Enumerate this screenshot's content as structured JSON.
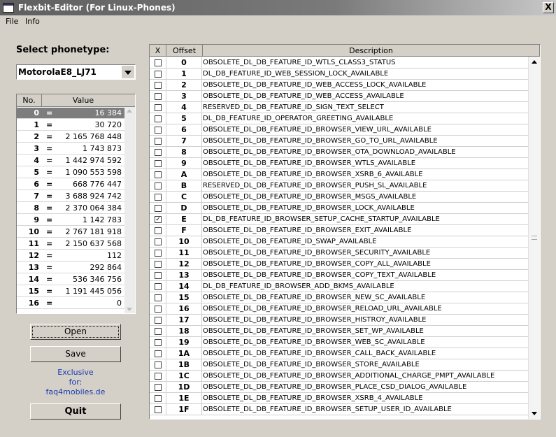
{
  "window": {
    "title": "Flexbit-Editor  (For Linux-Phones)",
    "close_label": "X"
  },
  "menu": [
    {
      "label": "File"
    },
    {
      "label": "Info"
    }
  ],
  "phonetype": {
    "heading": "Select phonetype:",
    "selected": "MotorolaE8_LJ71"
  },
  "value_table": {
    "headers": {
      "no": "No.",
      "value": "Value"
    },
    "selected_index": 0,
    "rows": [
      {
        "no": "0",
        "eq": "=",
        "value": "16 384"
      },
      {
        "no": "1",
        "eq": "=",
        "value": "30 720"
      },
      {
        "no": "2",
        "eq": "=",
        "value": "2 165 768 448"
      },
      {
        "no": "3",
        "eq": "=",
        "value": "1 743 873"
      },
      {
        "no": "4",
        "eq": "=",
        "value": "1 442 974 592"
      },
      {
        "no": "5",
        "eq": "=",
        "value": "1 090 553 598"
      },
      {
        "no": "6",
        "eq": "=",
        "value": "668 776 447"
      },
      {
        "no": "7",
        "eq": "=",
        "value": "3 688 924 742"
      },
      {
        "no": "8",
        "eq": "=",
        "value": "2 370 064 384"
      },
      {
        "no": "9",
        "eq": "=",
        "value": "1 142 783"
      },
      {
        "no": "10",
        "eq": "=",
        "value": "2 767 181 918"
      },
      {
        "no": "11",
        "eq": "=",
        "value": "2 150 637 568"
      },
      {
        "no": "12",
        "eq": "=",
        "value": "112"
      },
      {
        "no": "13",
        "eq": "=",
        "value": "292 864"
      },
      {
        "no": "14",
        "eq": "=",
        "value": "536 346 756"
      },
      {
        "no": "15",
        "eq": "=",
        "value": "1 191 445 056"
      },
      {
        "no": "16",
        "eq": "=",
        "value": "0"
      }
    ]
  },
  "buttons": {
    "open": "Open",
    "save": "Save",
    "quit": "Quit"
  },
  "exclusive": {
    "line1": "Exclusive",
    "line2": "for:",
    "line3": "faq4mobiles.de"
  },
  "feature_table": {
    "headers": {
      "check": "X",
      "offset": "Offset",
      "description": "Description"
    },
    "rows": [
      {
        "checked": false,
        "offset": "0",
        "description": "OBSOLETE_DL_DB_FEATURE_ID_WTLS_CLASS3_STATUS"
      },
      {
        "checked": false,
        "offset": "1",
        "description": "DL_DB_FEATURE_ID_WEB_SESSION_LOCK_AVAILABLE"
      },
      {
        "checked": false,
        "offset": "2",
        "description": "OBSOLETE_DL_DB_FEATURE_ID_WEB_ACCESS_LOCK_AVAILABLE"
      },
      {
        "checked": false,
        "offset": "3",
        "description": "OBSOLETE_DL_DB_FEATURE_ID_WEB_ACCESS_AVAILABLE"
      },
      {
        "checked": false,
        "offset": "4",
        "description": "RESERVED_DL_DB_FEATURE_ID_SIGN_TEXT_SELECT"
      },
      {
        "checked": false,
        "offset": "5",
        "description": "DL_DB_FEATURE_ID_OPERATOR_GREETING_AVAILABLE"
      },
      {
        "checked": false,
        "offset": "6",
        "description": "OBSOLETE_DL_DB_FEATURE_ID_BROWSER_VIEW_URL_AVAILABLE"
      },
      {
        "checked": false,
        "offset": "7",
        "description": "OBSOLETE_DL_DB_FEATURE_ID_BROWSER_GO_TO_URL_AVAILABLE"
      },
      {
        "checked": false,
        "offset": "8",
        "description": "OBSOLETE_DL_DB_FEATURE_ID_BROWSER_OTA_DOWNLOAD_AVAILABLE"
      },
      {
        "checked": false,
        "offset": "9",
        "description": "OBSOLETE_DL_DB_FEATURE_ID_BROWSER_WTLS_AVAILABLE"
      },
      {
        "checked": false,
        "offset": "A",
        "description": "OBSOLETE_DL_DB_FEATURE_ID_BROWSER_XSRB_6_AVAILABLE"
      },
      {
        "checked": false,
        "offset": "B",
        "description": "RESERVED_DL_DB_FEATURE_ID_BROWSER_PUSH_SL_AVAILABLE"
      },
      {
        "checked": false,
        "offset": "C",
        "description": "OBSOLETE_DL_DB_FEATURE_ID_BROWSER_MSGS_AVAILABLE"
      },
      {
        "checked": false,
        "offset": "D",
        "description": "OBSOLETE_DL_DB_FEATURE_ID_BROWSER_LOCK_AVAILABLE"
      },
      {
        "checked": true,
        "offset": "E",
        "description": "DL_DB_FEATURE_ID_BROWSER_SETUP_CACHE_STARTUP_AVAILABLE"
      },
      {
        "checked": false,
        "offset": "F",
        "description": "OBSOLETE_DL_DB_FEATURE_ID_BROWSER_EXIT_AVAILABLE"
      },
      {
        "checked": false,
        "offset": "10",
        "description": "OBSOLETE_DL_DB_FEATURE_ID_SWAP_AVAILABLE"
      },
      {
        "checked": false,
        "offset": "11",
        "description": "OBSOLETE_DL_DB_FEATURE_ID_BROWSER_SECURITY_AVAILABLE"
      },
      {
        "checked": false,
        "offset": "12",
        "description": "OBSOLETE_DL_DB_FEATURE_ID_BROWSER_COPY_ALL_AVAILABLE"
      },
      {
        "checked": false,
        "offset": "13",
        "description": "OBSOLETE_DL_DB_FEATURE_ID_BROWSER_COPY_TEXT_AVAILABLE"
      },
      {
        "checked": false,
        "offset": "14",
        "description": "DL_DB_FEATURE_ID_BROWSER_ADD_BKMS_AVAILABLE"
      },
      {
        "checked": false,
        "offset": "15",
        "description": "OBSOLETE_DL_DB_FEATURE_ID_BROWSER_NEW_SC_AVAILABLE"
      },
      {
        "checked": false,
        "offset": "16",
        "description": "OBSOLETE_DL_DB_FEATURE_ID_BROWSER_RELOAD_URL_AVAILABLE"
      },
      {
        "checked": false,
        "offset": "17",
        "description": "OBSOLETE_DL_DB_FEATURE_ID_BROWSER_HISTROY_AVAILABLE"
      },
      {
        "checked": false,
        "offset": "18",
        "description": "OBSOLETE_DL_DB_FEATURE_ID_BROWSER_SET_WP_AVAILABLE"
      },
      {
        "checked": false,
        "offset": "19",
        "description": "OBSOLETE_DL_DB_FEATURE_ID_BROWSER_WEB_SC_AVAILABLE"
      },
      {
        "checked": false,
        "offset": "1A",
        "description": "OBSOLETE_DL_DB_FEATURE_ID_BROWSER_CALL_BACK_AVAILABLE"
      },
      {
        "checked": false,
        "offset": "1B",
        "description": "OBSOLETE_DL_DB_FEATURE_ID_BROWSER_STORE_AVAILABLE"
      },
      {
        "checked": false,
        "offset": "1C",
        "description": "OBSOLETE_DL_DB_FEATURE_ID_BROWSER_ADDITIONAL_CHARGE_PMPT_AVAILABLE"
      },
      {
        "checked": false,
        "offset": "1D",
        "description": "OBSOLETE_DL_DB_FEATURE_ID_BROWSER_PLACE_CSD_DIALOG_AVAILABLE"
      },
      {
        "checked": false,
        "offset": "1E",
        "description": "OBSOLETE_DL_DB_FEATURE_ID_BROWSER_XSRB_4_AVAILABLE"
      },
      {
        "checked": false,
        "offset": "1F",
        "description": "OBSOLETE_DL_DB_FEATURE_ID_BROWSER_SETUP_USER_ID_AVAILABLE"
      }
    ]
  }
}
